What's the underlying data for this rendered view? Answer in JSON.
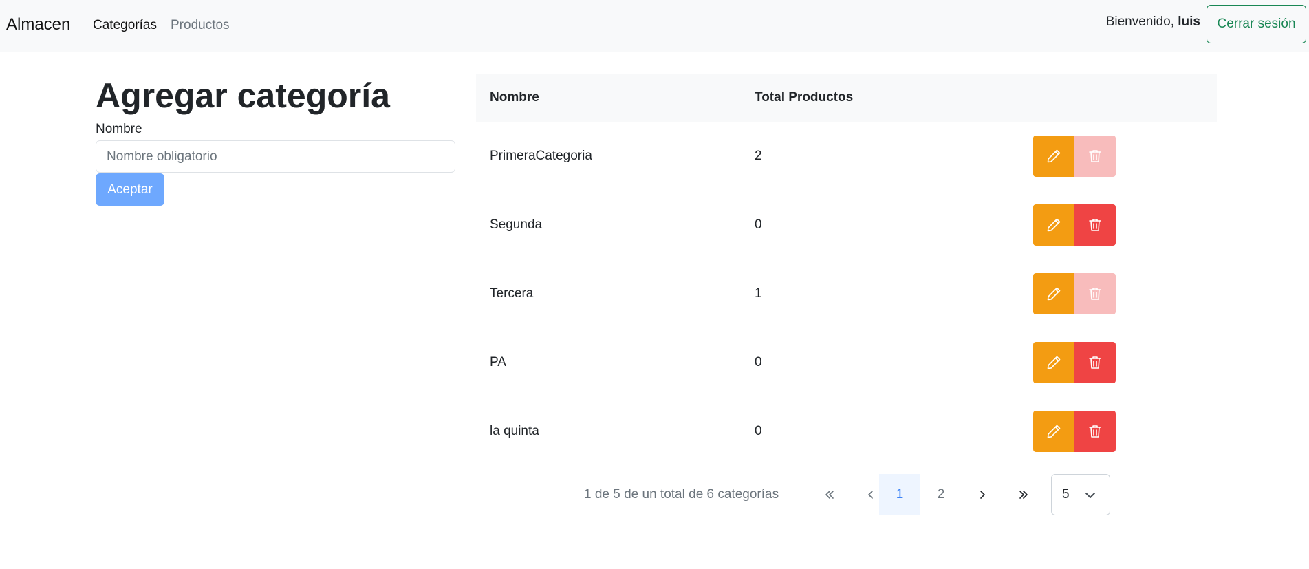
{
  "nav": {
    "brand": "Almacen",
    "links": [
      {
        "label": "Categorías",
        "active": true
      },
      {
        "label": "Productos",
        "active": false
      }
    ],
    "welcome_prefix": "Bienvenido,",
    "username": "luis",
    "logout_label": "Cerrar sesión"
  },
  "form": {
    "title": "Agregar categoría",
    "name_label": "Nombre",
    "name_placeholder": "Nombre obligatorio",
    "submit_label": "Aceptar"
  },
  "table": {
    "headers": {
      "name": "Nombre",
      "total": "Total Productos"
    },
    "rows": [
      {
        "name": "PrimeraCategoria",
        "total": "2",
        "delete_enabled": false
      },
      {
        "name": "Segunda",
        "total": "0",
        "delete_enabled": true
      },
      {
        "name": "Tercera",
        "total": "1",
        "delete_enabled": false
      },
      {
        "name": "PA",
        "total": "0",
        "delete_enabled": true
      },
      {
        "name": "la quinta",
        "total": "0",
        "delete_enabled": true
      }
    ]
  },
  "pagination": {
    "summary": "1 de 5 de un total de 6 categorías",
    "pages": [
      "1",
      "2"
    ],
    "current_page": "1",
    "page_size": "5",
    "icons": {
      "first": "double-chevron-left-icon",
      "prev": "chevron-left-icon",
      "next": "chevron-right-icon",
      "last": "double-chevron-right-icon"
    }
  },
  "colors": {
    "edit": "#f39c12",
    "delete": "#ef4444",
    "delete_disabled": "#f8bcbc",
    "primary_disabled": "#6ea8fe",
    "success": "#198754"
  }
}
